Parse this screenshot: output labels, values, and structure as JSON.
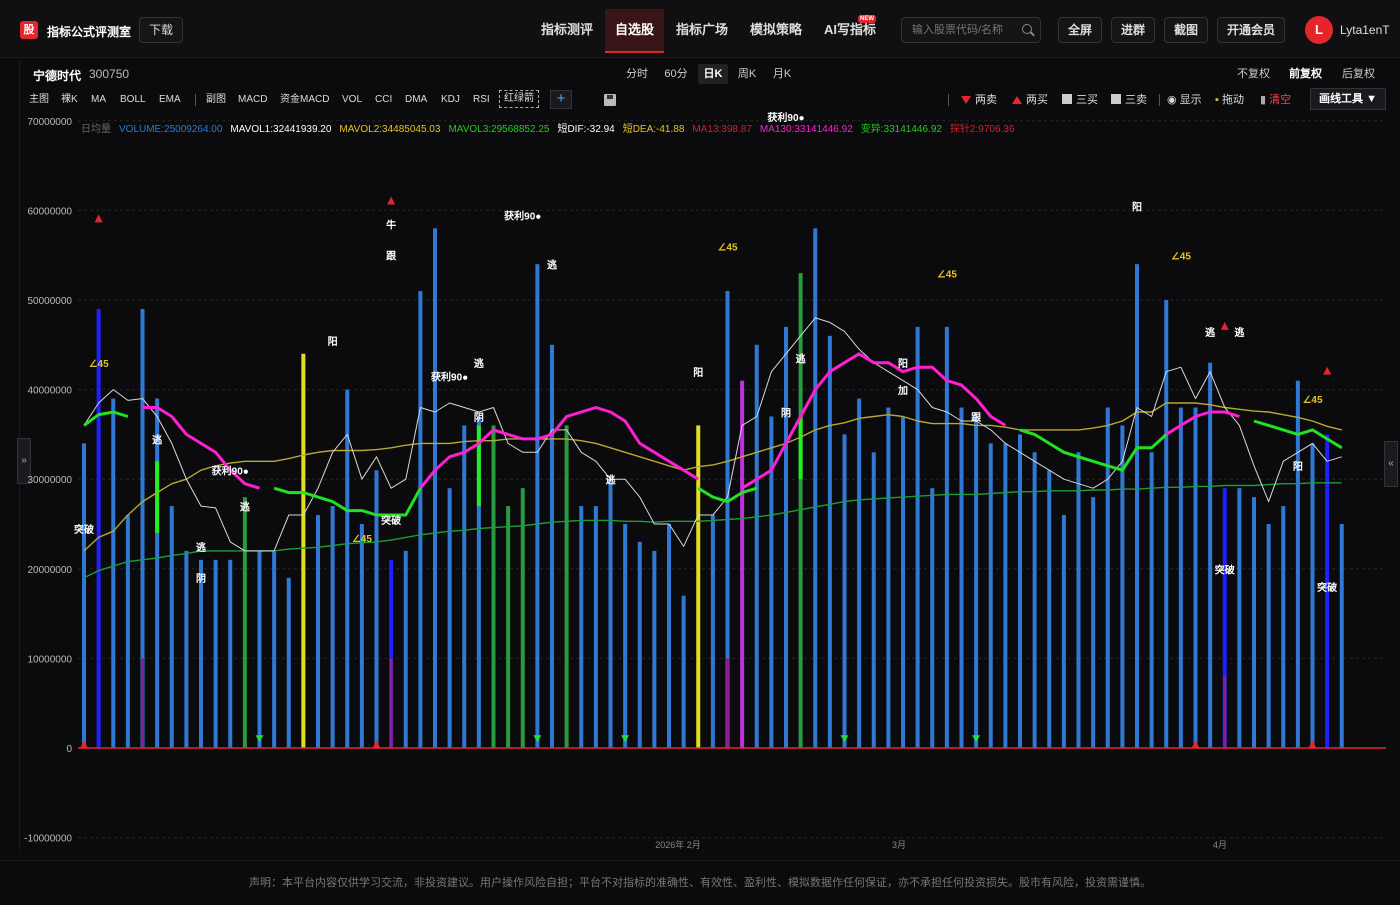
{
  "app": {
    "logo": "股",
    "title": "指标公式评测室",
    "download": "下载"
  },
  "nav": [
    {
      "label": "指标测评",
      "active": false
    },
    {
      "label": "自选股",
      "active": true
    },
    {
      "label": "指标广场",
      "active": false
    },
    {
      "label": "模拟策略",
      "active": false
    },
    {
      "label": "AI写指标",
      "active": false,
      "badge": "NEW"
    }
  ],
  "search": {
    "placeholder": "输入股票代码/名称"
  },
  "top_buttons": [
    "全屏",
    "进群",
    "截图",
    "开通会员"
  ],
  "user": {
    "avatar": "L",
    "name": "Lyta1enT"
  },
  "stock": {
    "name": "宁德时代",
    "code": "300750"
  },
  "periods": [
    {
      "label": "分时",
      "active": false
    },
    {
      "label": "60分",
      "active": false
    },
    {
      "label": "日K",
      "active": true
    },
    {
      "label": "周K",
      "active": false
    },
    {
      "label": "月K",
      "active": false
    }
  ],
  "adjust": [
    {
      "label": "不复权",
      "active": false
    },
    {
      "label": "前复权",
      "active": true
    },
    {
      "label": "后复权",
      "active": false
    }
  ],
  "indicators_main": [
    "主图",
    "裸K",
    "MA",
    "BOLL",
    "EMA"
  ],
  "indicators_sub": [
    "副图",
    "MACD",
    "资金MACD",
    "VOL",
    "CCI",
    "DMA",
    "KDJ",
    "RSI"
  ],
  "red_green": "红绿箭",
  "right_tools": {
    "sell2": "两卖",
    "buy2": "两买",
    "buy3": "三买",
    "sell3": "三卖",
    "show": "显示",
    "drag": "拖动",
    "clear": "清空",
    "drawtool": "画线工具"
  },
  "colors": {
    "vol_bar": "#2f78d4",
    "pink": "#ff1fd2",
    "green_line": "#22e022",
    "olive": "#b8a832",
    "dark_green": "#1e9a3a",
    "white_line": "#d8d8d8",
    "red": "#e3262c"
  },
  "legend": [
    {
      "text": "日均量",
      "color": "#666"
    },
    {
      "text": "VOLUME:25009264.00",
      "color": "#2f78d4"
    },
    {
      "text": "MAVOL1:32441939.20",
      "color": "#ffffff"
    },
    {
      "text": "MAVOL2:34485045.03",
      "color": "#e6c520"
    },
    {
      "text": "MAVOL3:29568852.25",
      "color": "#22cc22"
    },
    {
      "text": "短DIF:-32.94",
      "color": "#ffffff"
    },
    {
      "text": "短DEA:-41.88",
      "color": "#e6c520"
    },
    {
      "text": "MA13:398.87",
      "color": "#d02030"
    },
    {
      "text": "MA130:33141446.92",
      "color": "#ff1fd2"
    },
    {
      "text": "变异:33141446.92",
      "color": "#22cc22"
    },
    {
      "text": "探针2:9706.36",
      "color": "#d02030"
    }
  ],
  "chart_data": {
    "type": "bar",
    "ylim": [
      -10000000,
      70000000
    ],
    "yticks": [
      "70000000",
      "60000000",
      "50000000",
      "40000000",
      "30000000",
      "20000000",
      "10000000",
      "0",
      "-10000000"
    ],
    "xticks": [
      "2026年 2月",
      "3月",
      "4月"
    ],
    "volume": [
      34,
      49,
      39,
      26,
      49,
      39,
      27,
      22,
      21,
      21,
      21,
      28,
      22,
      22,
      19,
      44,
      26,
      27,
      40,
      25,
      31,
      21,
      22,
      51,
      58,
      29,
      36,
      37,
      36,
      27,
      29,
      54,
      45,
      36,
      27,
      27,
      30,
      25,
      23,
      22,
      25,
      17,
      36,
      26,
      51,
      41,
      45,
      37,
      47,
      53,
      58,
      46,
      35,
      39,
      33,
      38,
      37,
      47,
      29,
      47,
      38,
      37,
      34,
      34,
      35,
      33,
      31,
      26,
      33,
      28,
      38,
      36,
      54,
      33,
      50,
      38,
      38,
      43,
      29,
      29,
      28,
      25,
      27,
      41,
      34,
      35,
      25
    ],
    "mavol1": [
      36,
      38.5,
      40,
      38.8,
      39,
      37,
      34,
      30,
      27,
      26.8,
      23,
      22,
      22,
      22,
      26,
      26,
      29,
      33,
      35,
      30,
      32.5,
      29,
      30,
      38,
      37.5,
      38.5,
      38,
      37.5,
      38,
      34,
      33,
      33,
      35.5,
      35.5,
      33,
      32,
      30,
      30,
      28,
      25,
      25,
      22.5,
      26,
      26,
      28,
      36,
      37,
      42,
      44,
      46,
      48,
      47.5,
      46.5,
      44.5,
      43,
      42,
      41,
      40,
      38,
      37.5,
      36.5,
      36.5,
      35.5,
      34,
      33,
      32,
      31,
      30,
      29.5,
      29,
      30,
      32,
      38,
      37,
      42,
      42.5,
      39,
      42,
      38,
      36,
      31.5,
      27.5,
      32,
      33,
      34,
      32,
      32.5
    ],
    "mavol2": [
      22,
      23.5,
      24.2,
      26,
      27.5,
      28.5,
      29.5,
      30,
      31,
      31.5,
      31.8,
      32,
      32,
      32,
      32.3,
      32.7,
      33,
      33.2,
      33.2,
      33.2,
      33.3,
      33.5,
      33.8,
      34,
      34,
      34,
      34.2,
      34.3,
      34.3,
      34.5,
      34.5,
      34.5,
      34.5,
      34.5,
      34.3,
      34,
      33.5,
      33,
      32.5,
      32,
      31.5,
      31,
      31.4,
      31.6,
      32,
      32.5,
      33,
      33.5,
      34,
      34.7,
      35.5,
      36,
      36.3,
      36.8,
      37,
      37.2,
      37,
      36.5,
      36.2,
      36.2,
      36.2,
      36,
      36,
      35.8,
      35.5,
      35.5,
      35.5,
      35.5,
      35.5,
      35.7,
      36,
      36.5,
      37.5,
      37.5,
      38.5,
      38.5,
      38.5,
      38.3,
      38,
      37.8,
      37.6,
      37.5,
      37.2,
      36.9,
      36.5,
      35.9,
      35.5
    ],
    "mavol3": [
      19,
      19.8,
      20.3,
      20.8,
      21,
      21.2,
      21.5,
      21.7,
      22,
      22,
      22,
      22,
      22,
      22,
      22.2,
      22.3,
      22.4,
      22.6,
      22.8,
      22.9,
      23,
      23.2,
      23.5,
      23.8,
      24,
      24.2,
      24.3,
      24.5,
      24.6,
      24.7,
      24.8,
      25,
      25.2,
      25.3,
      25.4,
      25.4,
      25.4,
      25.3,
      25.3,
      25.2,
      25.3,
      25.3,
      25.3,
      25.4,
      25.5,
      25.6,
      25.8,
      26,
      26.3,
      26.6,
      26.9,
      27.2,
      27.5,
      27.7,
      27.8,
      27.9,
      28,
      28.1,
      28.2,
      28.3,
      28.3,
      28.3,
      28.4,
      28.5,
      28.6,
      28.6,
      28.7,
      28.7,
      28.7,
      28.8,
      28.8,
      28.9,
      28.9,
      29,
      29.1,
      29.1,
      29.2,
      29.2,
      29.3,
      29.3,
      29.3,
      29.4,
      29.5,
      29.5,
      29.6,
      29.6,
      29.6
    ],
    "pink": [
      null,
      null,
      null,
      null,
      38,
      38,
      37,
      35,
      34,
      33,
      31,
      29.5,
      29,
      null,
      null,
      null,
      null,
      null,
      null,
      null,
      null,
      null,
      null,
      29,
      31,
      32.5,
      33,
      34,
      35.5,
      35,
      34.5,
      34.5,
      35,
      37,
      37.5,
      38,
      37.5,
      36.5,
      34,
      33,
      32,
      31,
      30,
      null,
      null,
      29,
      30,
      31,
      34,
      37,
      40,
      42,
      43,
      44,
      43,
      43,
      42,
      42.5,
      42.5,
      41,
      40.5,
      39,
      37,
      36,
      null,
      null,
      null,
      null,
      null,
      null,
      null,
      null,
      null,
      null,
      35,
      36,
      37,
      37.5,
      37.5,
      37,
      null,
      null,
      null,
      null,
      null,
      null,
      null
    ],
    "green_line": [
      36,
      37.2,
      37.5,
      37,
      null,
      null,
      null,
      null,
      null,
      null,
      null,
      null,
      null,
      29,
      28.5,
      28.5,
      28,
      27.5,
      26.5,
      26.5,
      26,
      26,
      26,
      29,
      null,
      null,
      null,
      null,
      null,
      null,
      null,
      null,
      null,
      null,
      null,
      null,
      null,
      null,
      null,
      null,
      null,
      null,
      29,
      28,
      27.5,
      28.5,
      29,
      null,
      null,
      null,
      null,
      null,
      null,
      null,
      null,
      null,
      null,
      null,
      null,
      null,
      null,
      null,
      null,
      null,
      35.5,
      35,
      34,
      33,
      32.5,
      32,
      31.5,
      31,
      33.5,
      33.5,
      35,
      null,
      null,
      null,
      null,
      null,
      36.5,
      36,
      35.5,
      35,
      35.5,
      34.5,
      33.5
    ],
    "markers": [
      {
        "type": "tri_red",
        "i": 1,
        "v": 59
      },
      {
        "type": "tri_red",
        "i": 21,
        "v": 61
      },
      {
        "type": "tri_red",
        "i": 78,
        "v": 47
      },
      {
        "type": "tri_red",
        "i": 85,
        "v": 42
      },
      {
        "type": "tri_green",
        "i": 12,
        "v": 0.3
      },
      {
        "type": "tri_green",
        "i": 31,
        "v": 0.3
      },
      {
        "type": "tri_green",
        "i": 37,
        "v": 0.3
      },
      {
        "type": "tri_green",
        "i": 52,
        "v": 0.3
      },
      {
        "type": "tri_green",
        "i": 61,
        "v": 0.3
      },
      {
        "type": "tri_red",
        "i": 0,
        "v": 0.3
      },
      {
        "type": "tri_red",
        "i": 20,
        "v": 0.3
      },
      {
        "type": "tri_red",
        "i": 76,
        "v": 0.3
      },
      {
        "type": "tri_red",
        "i": 84,
        "v": 0.3
      },
      {
        "type": "text",
        "i": 1,
        "v": 42.5,
        "text": "∠45",
        "color": "#e6c520"
      },
      {
        "type": "text",
        "i": 19,
        "v": 23,
        "text": "∠45",
        "color": "#e6c520"
      },
      {
        "type": "text",
        "i": 44,
        "v": 55.5,
        "text": "∠45",
        "color": "#e6c520"
      },
      {
        "type": "text",
        "i": 59,
        "v": 52.5,
        "text": "∠45",
        "color": "#e6c520"
      },
      {
        "type": "text",
        "i": 75,
        "v": 54.5,
        "text": "∠45",
        "color": "#e6c520"
      },
      {
        "type": "text",
        "i": 84,
        "v": 38.5,
        "text": "∠45",
        "color": "#e6c520"
      },
      {
        "type": "text",
        "i": 0,
        "v": 24,
        "text": "突破",
        "color": "#ffffff"
      },
      {
        "type": "text",
        "i": 21,
        "v": 25,
        "text": "突破",
        "color": "#ffffff"
      },
      {
        "type": "text",
        "i": 78,
        "v": 19.5,
        "text": "突破",
        "color": "#ffffff"
      },
      {
        "type": "text",
        "i": 85,
        "v": 17.5,
        "text": "突破",
        "color": "#ffffff"
      },
      {
        "type": "text",
        "i": 5,
        "v": 34,
        "text": "逃",
        "color": "#ffffff"
      },
      {
        "type": "text",
        "i": 8,
        "v": 22,
        "text": "逃",
        "color": "#ffffff"
      },
      {
        "type": "text",
        "i": 11,
        "v": 26.5,
        "text": "逃",
        "color": "#ffffff"
      },
      {
        "type": "text",
        "i": 27,
        "v": 42.5,
        "text": "逃",
        "color": "#ffffff"
      },
      {
        "type": "text",
        "i": 32,
        "v": 53.5,
        "text": "逃",
        "color": "#ffffff"
      },
      {
        "type": "text",
        "i": 36,
        "v": 29.5,
        "text": "逃",
        "color": "#ffffff"
      },
      {
        "type": "text",
        "i": 49,
        "v": 43,
        "text": "逃",
        "color": "#ffffff"
      },
      {
        "type": "text",
        "i": 77,
        "v": 46,
        "text": "逃",
        "color": "#ffffff"
      },
      {
        "type": "text",
        "i": 79,
        "v": 46,
        "text": "逃",
        "color": "#ffffff"
      },
      {
        "type": "text",
        "i": 8,
        "v": 18.5,
        "text": "阴",
        "color": "#ffffff"
      },
      {
        "type": "text",
        "i": 27,
        "v": 36.5,
        "text": "阴",
        "color": "#ffffff"
      },
      {
        "type": "text",
        "i": 48,
        "v": 37,
        "text": "阴",
        "color": "#ffffff"
      },
      {
        "type": "text",
        "i": 17,
        "v": 45,
        "text": "阳",
        "color": "#ffffff"
      },
      {
        "type": "text",
        "i": 42,
        "v": 41.5,
        "text": "阳",
        "color": "#ffffff"
      },
      {
        "type": "text",
        "i": 56,
        "v": 42.5,
        "text": "阳",
        "color": "#ffffff"
      },
      {
        "type": "text",
        "i": 72,
        "v": 60,
        "text": "阳",
        "color": "#ffffff"
      },
      {
        "type": "text",
        "i": 83,
        "v": 31,
        "text": "阳",
        "color": "#ffffff"
      },
      {
        "type": "text",
        "i": 21,
        "v": 58,
        "text": "牛",
        "color": "#ffffff"
      },
      {
        "type": "text",
        "i": 21,
        "v": 54.5,
        "text": "跟",
        "color": "#ffffff"
      },
      {
        "type": "text",
        "i": 61,
        "v": 36.5,
        "text": "跟",
        "color": "#ffffff"
      },
      {
        "type": "text",
        "i": 56,
        "v": 39.5,
        "text": "加",
        "color": "#ffffff"
      },
      {
        "type": "text",
        "i": 10,
        "v": 30.5,
        "text": "获利90●",
        "color": "#ffffff"
      },
      {
        "type": "text",
        "i": 25,
        "v": 41,
        "text": "获利90●",
        "color": "#ffffff"
      },
      {
        "type": "text",
        "i": 30,
        "v": 59,
        "text": "获利90●",
        "color": "#ffffff"
      },
      {
        "type": "text",
        "i": 48,
        "v": 70,
        "text": "获利90●",
        "color": "#ffffff"
      }
    ]
  },
  "disclaimer": "声明：本平台内容仅供学习交流，非投资建议。用户操作风险自担；平台不对指标的准确性、有效性、盈利性、模拟数据作任何保证，亦不承担任何投资损失。股市有风险，投资需谨慎。"
}
